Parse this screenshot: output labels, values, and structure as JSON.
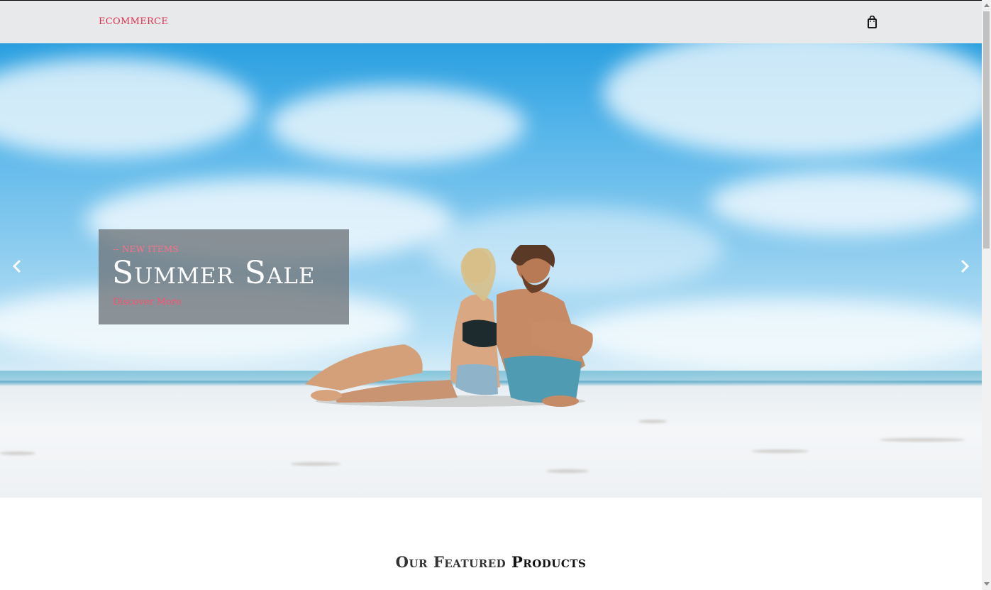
{
  "header": {
    "brand": "ECOMMERCE",
    "cart_icon": "shopping-bag-icon"
  },
  "hero": {
    "kicker": "-- NEW ITEMS",
    "title": "Summer Sale",
    "cta": "Discover More",
    "prev_icon": "chevron-left-icon",
    "next_icon": "chevron-right-icon"
  },
  "featured": {
    "heading_light": "Our Featured",
    "heading_bold": "Products"
  },
  "colors": {
    "accent": "#e0304f",
    "header_bg": "#e8e9ea",
    "caption_bg": "#6e747a"
  }
}
